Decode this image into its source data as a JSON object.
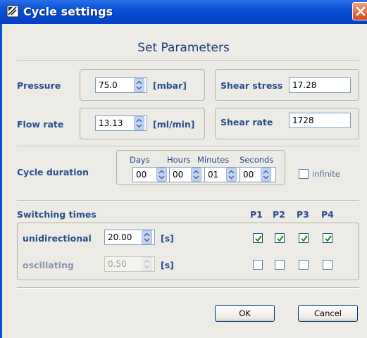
{
  "window": {
    "title": "Cycle settings"
  },
  "heading": "Set Parameters",
  "pressure": {
    "label": "Pressure",
    "value": "75.0",
    "unit": "[mbar]"
  },
  "flow_rate": {
    "label": "Flow rate",
    "value": "13.13",
    "unit": "[ml/min]"
  },
  "shear_stress": {
    "label": "Shear stress",
    "value": "17.28"
  },
  "shear_rate": {
    "label": "Shear rate",
    "value": "1728"
  },
  "cycle": {
    "label": "Cycle duration",
    "days_label": "Days",
    "hours_label": "Hours",
    "minutes_label": "Minutes",
    "seconds_label": "Seconds",
    "days": "00",
    "hours": "00",
    "minutes": "01",
    "seconds": "00",
    "infinite_label": "infinite",
    "infinite_checked": false
  },
  "switching": {
    "title": "Switching times",
    "columns": [
      "P1",
      "P2",
      "P3",
      "P4"
    ],
    "unidirectional": {
      "label": "unidirectional",
      "value": "20.00",
      "unit": "[s]",
      "checks": [
        true,
        true,
        true,
        true
      ]
    },
    "oscillating": {
      "label": "oscillating",
      "value": "0.50",
      "unit": "[s]",
      "checks": [
        false,
        false,
        false,
        false
      ]
    }
  },
  "buttons": {
    "ok": "OK",
    "cancel": "Cancel"
  },
  "colors": {
    "titlebar": "#0a4fd8",
    "label": "#2a4d8c",
    "check": "#1c8a1c"
  }
}
